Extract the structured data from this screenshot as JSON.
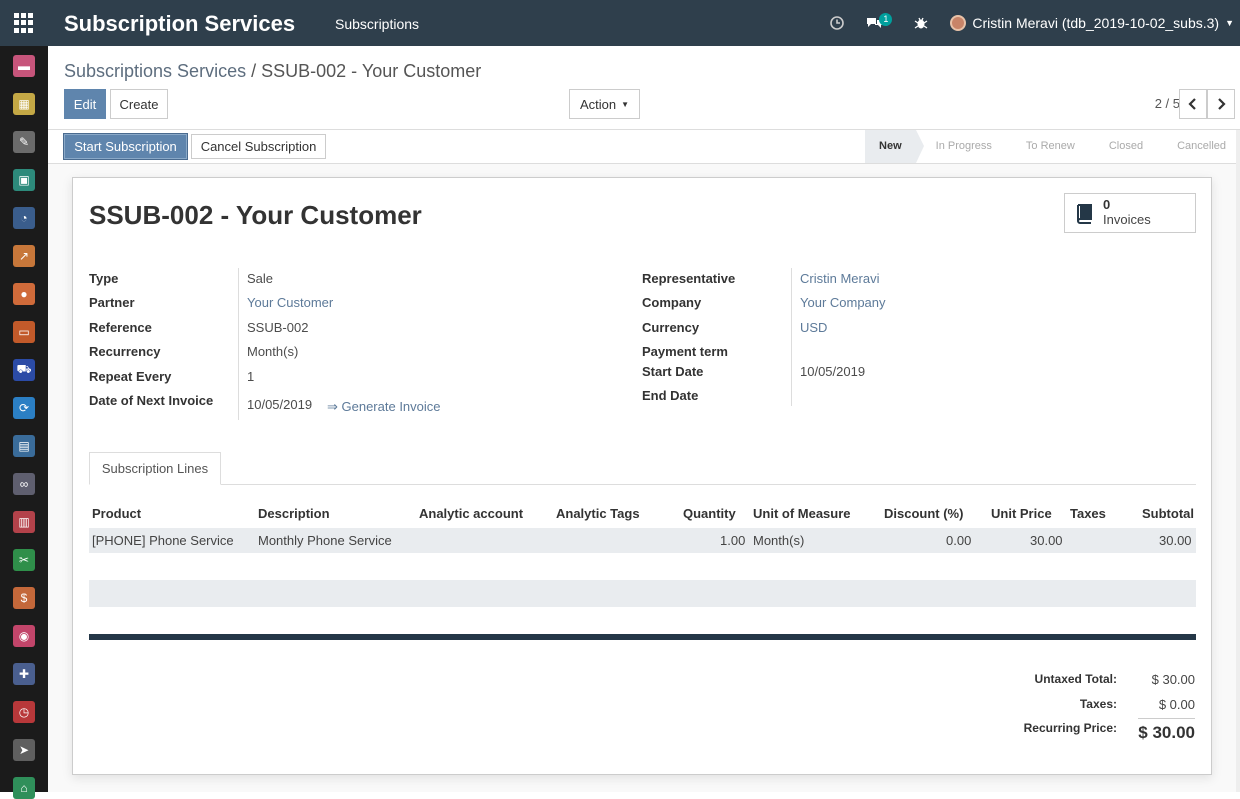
{
  "topbar": {
    "app_title": "Subscription Services",
    "menu": "Subscriptions",
    "chat_badge": "1",
    "user": "Cristin Meravi (tdb_2019-10-02_subs.3)"
  },
  "breadcrumb": {
    "parent": "Subscriptions Services",
    "sep": "/",
    "current": "SSUB-002 - Your Customer"
  },
  "buttons": {
    "edit": "Edit",
    "create": "Create",
    "action": "Action",
    "start": "Start Subscription",
    "cancel": "Cancel Subscription"
  },
  "pager": {
    "text": "2 / 5"
  },
  "stages": [
    "New",
    "In Progress",
    "To Renew",
    "Closed",
    "Cancelled"
  ],
  "record": {
    "title": "SSUB-002 - Your Customer",
    "invoices_count": "0",
    "invoices_label": "Invoices"
  },
  "left_fields": [
    {
      "label": "Type",
      "value": "Sale"
    },
    {
      "label": "Partner",
      "value": "Your Customer"
    },
    {
      "label": "Reference",
      "value": "SSUB-002"
    },
    {
      "label": "Recurrency",
      "value": "Month(s)"
    },
    {
      "label": "Repeat Every",
      "value": "1"
    },
    {
      "label": "Date of Next Invoice",
      "value": "10/05/2019"
    }
  ],
  "generate_invoice": "⇒ Generate Invoice",
  "right_fields": [
    {
      "label": "Representative",
      "value": "Cristin Meravi"
    },
    {
      "label": "Company",
      "value": "Your Company"
    },
    {
      "label": "Currency",
      "value": "USD"
    },
    {
      "label": "Payment term",
      "value": ""
    },
    {
      "label": "Start Date",
      "value": "10/05/2019"
    },
    {
      "label": "End Date",
      "value": ""
    }
  ],
  "tab": "Subscription Lines",
  "table": {
    "headers": [
      "Product",
      "Description",
      "Analytic account",
      "Analytic Tags",
      "Quantity",
      "Unit of Measure",
      "Discount (%)",
      "Unit Price",
      "Taxes",
      "Subtotal"
    ],
    "row": [
      "[PHONE] Phone Service",
      "Monthly Phone Service",
      "",
      "",
      "1.00",
      "Month(s)",
      "0.00",
      "30.00",
      "",
      "30.00"
    ]
  },
  "totals": {
    "untaxed_label": "Untaxed Total:",
    "untaxed_value": "$ 30.00",
    "taxes_label": "Taxes:",
    "taxes_value": "$ 0.00",
    "recurring_label": "Recurring Price:",
    "recurring_value": "$ 30.00"
  },
  "colors": {
    "topbar": "#2f3f4c",
    "primary": "#5f85ad",
    "link": "#5d7a99"
  }
}
